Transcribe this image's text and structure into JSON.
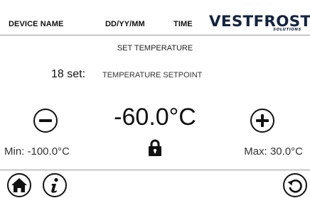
{
  "header": {
    "device_name": "DEVICE NAME",
    "date_format": "DD/YY/MM",
    "time": "TIME",
    "logo": {
      "brand": "VESTFROST",
      "sub": "SOLUTIONS",
      "color": "#13233f"
    }
  },
  "main": {
    "title": "SET TEMPERATURE",
    "param_id": "18 set:",
    "param_name": "TEMPERATURE SETPOINT",
    "value": "-60.0°C",
    "min": "Min: -100.0°C",
    "max": "Max: 30.0°C",
    "decrement_icon": "minus-circle-icon",
    "increment_icon": "plus-circle-icon",
    "lock_icon": "lock-icon"
  },
  "footer": {
    "home_icon": "home-icon",
    "info_icon": "info-icon",
    "back_icon": "back-arrow-icon"
  }
}
